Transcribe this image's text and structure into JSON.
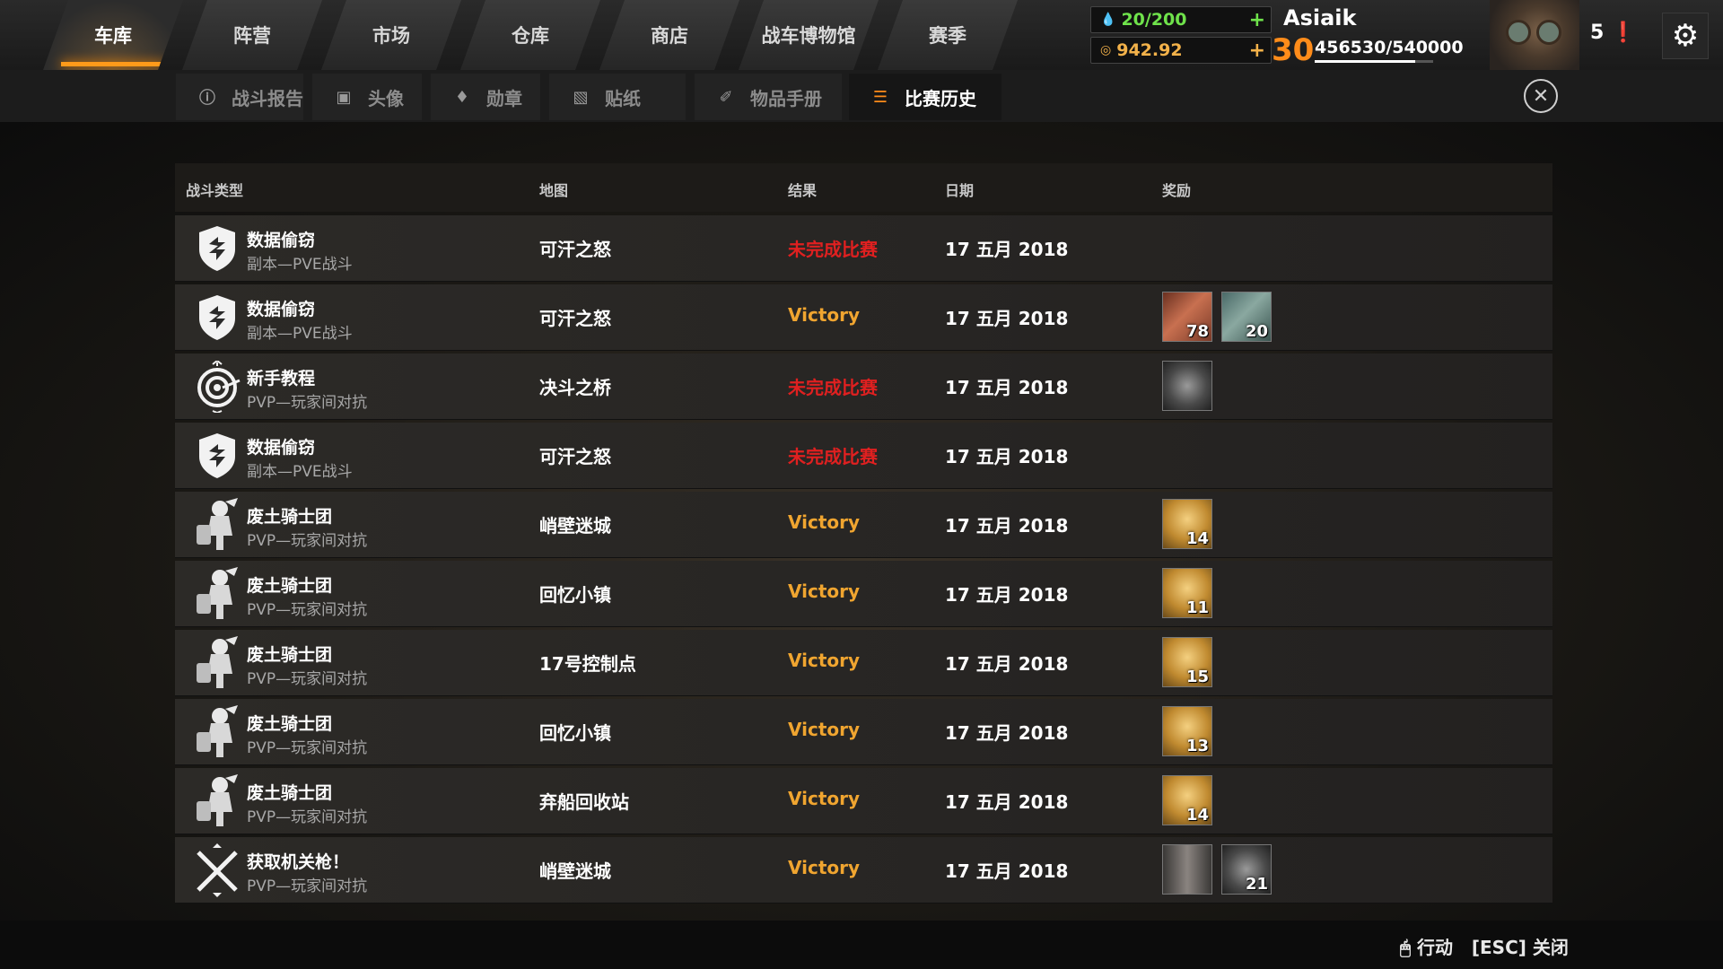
{
  "nav": {
    "tabs": [
      {
        "label": "车库",
        "active": true
      },
      {
        "label": "阵营"
      },
      {
        "label": "市场"
      },
      {
        "label": "仓库"
      },
      {
        "label": "商店"
      },
      {
        "label": "战车博物馆"
      },
      {
        "label": "赛季"
      }
    ]
  },
  "resources": {
    "fuel": "20/200",
    "coins": "942.92"
  },
  "player": {
    "name": "Asiaik",
    "level": "30",
    "xp": "456530/540000",
    "xp_progress": 0.845,
    "notifications": "5"
  },
  "subtabs": [
    {
      "label": "战斗报告",
      "icon": "info-icon"
    },
    {
      "label": "头像",
      "icon": "portrait-icon"
    },
    {
      "label": "勋章",
      "icon": "medal-icon"
    },
    {
      "label": "贴纸",
      "icon": "sticker-icon"
    },
    {
      "label": "物品手册",
      "icon": "handbook-icon"
    },
    {
      "label": "比赛历史",
      "icon": "history-icon",
      "active": true
    }
  ],
  "table": {
    "headers": {
      "type": "战斗类型",
      "map": "地图",
      "result": "结果",
      "date": "日期",
      "reward": "奖励"
    },
    "rows": [
      {
        "icon": "shield-icon",
        "title": "数据偷窃",
        "mode": "副本—PVE战斗",
        "map": "可汗之怒",
        "result": "未完成比赛",
        "result_type": "lose",
        "date": "17 五月 2018",
        "rewards": []
      },
      {
        "icon": "shield-icon",
        "title": "数据偷窃",
        "mode": "副本—PVE战斗",
        "map": "可汗之怒",
        "result": "Victory",
        "result_type": "win",
        "date": "17 五月 2018",
        "rewards": [
          {
            "kind": "copper",
            "qty": "78"
          },
          {
            "kind": "cloth",
            "qty": "20"
          }
        ]
      },
      {
        "icon": "target-icon",
        "title": "新手教程",
        "mode": "PVP—玩家间对抗",
        "map": "决斗之桥",
        "result": "未完成比赛",
        "result_type": "lose",
        "date": "17 五月 2018",
        "rewards": [
          {
            "kind": "parts",
            "qty": ""
          }
        ]
      },
      {
        "icon": "shield-icon",
        "title": "数据偷窃",
        "mode": "副本—PVE战斗",
        "map": "可汗之怒",
        "result": "未完成比赛",
        "result_type": "lose",
        "date": "17 五月 2018",
        "rewards": []
      },
      {
        "icon": "knight-icon",
        "title": "废土骑士团",
        "mode": "PVP—玩家间对抗",
        "map": "峭壁迷城",
        "result": "Victory",
        "result_type": "win",
        "date": "17 五月 2018",
        "rewards": [
          {
            "kind": "gold",
            "qty": "14"
          }
        ]
      },
      {
        "icon": "knight-icon",
        "title": "废土骑士团",
        "mode": "PVP—玩家间对抗",
        "map": "回忆小镇",
        "result": "Victory",
        "result_type": "win",
        "date": "17 五月 2018",
        "rewards": [
          {
            "kind": "gold",
            "qty": "11"
          }
        ]
      },
      {
        "icon": "knight-icon",
        "title": "废土骑士团",
        "mode": "PVP—玩家间对抗",
        "map": "17号控制点",
        "result": "Victory",
        "result_type": "win",
        "date": "17 五月 2018",
        "rewards": [
          {
            "kind": "gold",
            "qty": "15"
          }
        ]
      },
      {
        "icon": "knight-icon",
        "title": "废土骑士团",
        "mode": "PVP—玩家间对抗",
        "map": "回忆小镇",
        "result": "Victory",
        "result_type": "win",
        "date": "17 五月 2018",
        "rewards": [
          {
            "kind": "gold",
            "qty": "13"
          }
        ]
      },
      {
        "icon": "knight-icon",
        "title": "废土骑士团",
        "mode": "PVP—玩家间对抗",
        "map": "弃船回收站",
        "result": "Victory",
        "result_type": "win",
        "date": "17 五月 2018",
        "rewards": [
          {
            "kind": "gold",
            "qty": "14"
          }
        ]
      },
      {
        "icon": "crossed-guns-icon",
        "title": "获取机关枪！",
        "mode": "PVP—玩家间对抗",
        "map": "峭壁迷城",
        "result": "Victory",
        "result_type": "win",
        "date": "17 五月 2018",
        "rewards": [
          {
            "kind": "barrel",
            "qty": ""
          },
          {
            "kind": "parts",
            "qty": "21"
          }
        ]
      }
    ]
  },
  "footer": {
    "hint": "行动   [ESC] 关闭"
  },
  "colors": {
    "accent": "#ff8c1a",
    "victory": "#f0a530",
    "incomplete": "#e02020",
    "fuel": "#6fe24b"
  }
}
